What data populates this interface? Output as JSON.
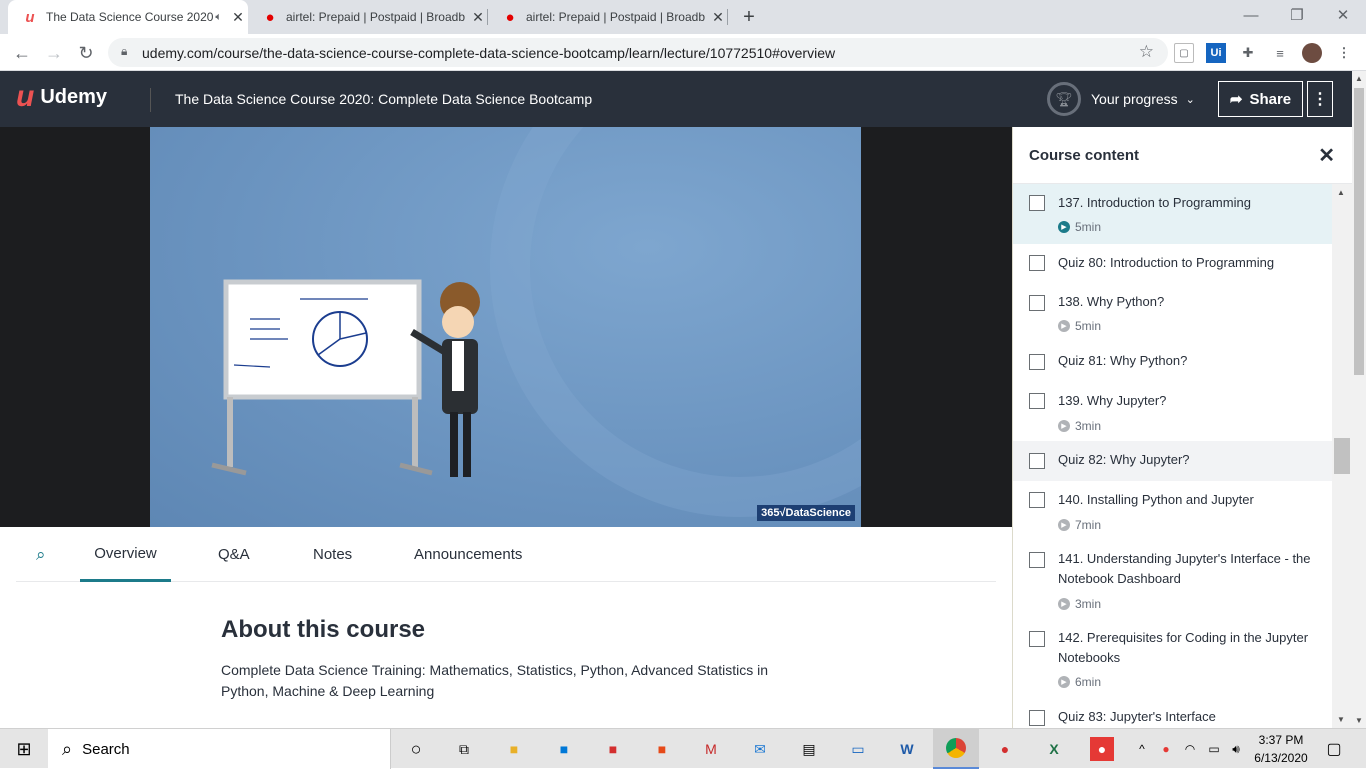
{
  "browser": {
    "tabs": [
      {
        "title": "The Data Science Course 2020",
        "favicon": "udemy-icon",
        "active": true
      },
      {
        "title": "airtel: Prepaid | Postpaid | Broadb",
        "favicon": "airtel-icon",
        "active": false
      },
      {
        "title": "airtel: Prepaid | Postpaid | Broadb",
        "favicon": "airtel-icon",
        "active": false
      }
    ],
    "new_tab": "+",
    "url": "udemy.com/course/the-data-science-course-complete-data-science-bootcamp/learn/lecture/10772510#overview"
  },
  "header": {
    "logo_text": "Udemy",
    "course_title": "The Data Science Course 2020: Complete Data Science Bootcamp",
    "progress_label": "Your progress",
    "share_label": "Share",
    "more": "⋮"
  },
  "video": {
    "brand": "365√DataScience"
  },
  "lower_tabs": [
    "Overview",
    "Q&A",
    "Notes",
    "Announcements"
  ],
  "about": {
    "heading": "About this course",
    "text": "Complete Data Science Training: Mathematics, Statistics, Python, Advanced Statistics in Python, Machine & Deep Learning"
  },
  "sidebar": {
    "title": "Course content",
    "items": [
      {
        "label": "137. Introduction to Programming",
        "duration": "5min"
      },
      {
        "label": "Quiz 80: Introduction to Programming",
        "duration": ""
      },
      {
        "label": "138. Why Python?",
        "duration": "5min"
      },
      {
        "label": "Quiz 81: Why Python?",
        "duration": ""
      },
      {
        "label": "139. Why Jupyter?",
        "duration": "3min"
      },
      {
        "label": "Quiz 82: Why Jupyter?",
        "duration": ""
      },
      {
        "label": "140. Installing Python and Jupyter",
        "duration": "7min"
      },
      {
        "label": "141. Understanding Jupyter's Interface - the Notebook Dashboard",
        "duration": "3min"
      },
      {
        "label": "142. Prerequisites for Coding in the Jupyter Notebooks",
        "duration": "6min"
      },
      {
        "label": "Quiz 83: Jupyter's Interface",
        "duration": ""
      }
    ]
  },
  "taskbar": {
    "search_label": "Search",
    "time": "3:37 PM",
    "date": "6/13/2020"
  },
  "colors": {
    "udemy_red": "#ec5252",
    "header_bg": "#29303b",
    "accent_teal": "#1c7b8a"
  }
}
